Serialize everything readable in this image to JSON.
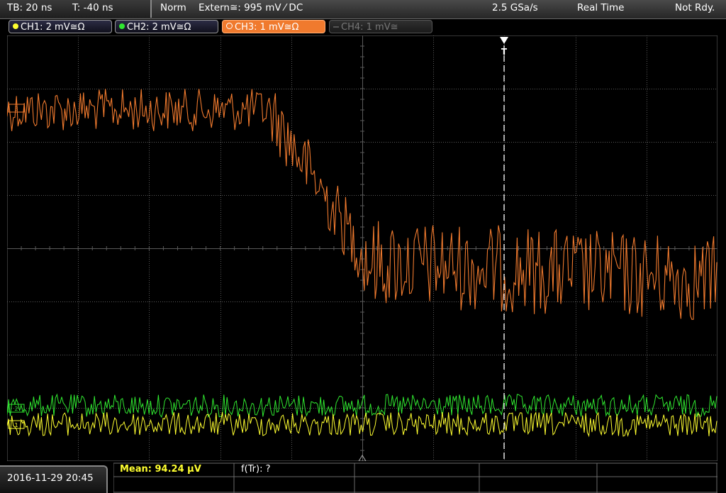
{
  "topbar": {
    "timebase": "TB: 20 ns",
    "trigger_offset": "T: -40 ns",
    "trigger_mode": "Norm",
    "trigger_source": "Extern≅: 995 mV ⁄ DC",
    "sample_rate": "2.5 GSa/s",
    "acq_mode": "Real Time",
    "status": "Not Rdy."
  },
  "channels": [
    {
      "label": "CH1: 2 mV≅Ω",
      "color": "#ffff30",
      "active": true
    },
    {
      "label": "CH2: 2 mV≅Ω",
      "color": "#30e830",
      "active": true
    },
    {
      "label": "CH3: 1 mV≅Ω",
      "color": "#f07a2e",
      "active": true,
      "selected": true
    },
    {
      "label": "CH4: 1 mV≅",
      "color": "#777777",
      "active": false
    }
  ],
  "trigger_marker": "T",
  "measurements": {
    "mean": "Mean: 94.24 µV",
    "rise_freq": "f(Tr): ?"
  },
  "datetime": "2016-11-29 20:45",
  "colors": {
    "grid": "#5a5a5a",
    "ch1": "#ffff30",
    "ch2": "#30e830",
    "ch3": "#f07a2e",
    "meas_text": "#ffff30"
  }
}
